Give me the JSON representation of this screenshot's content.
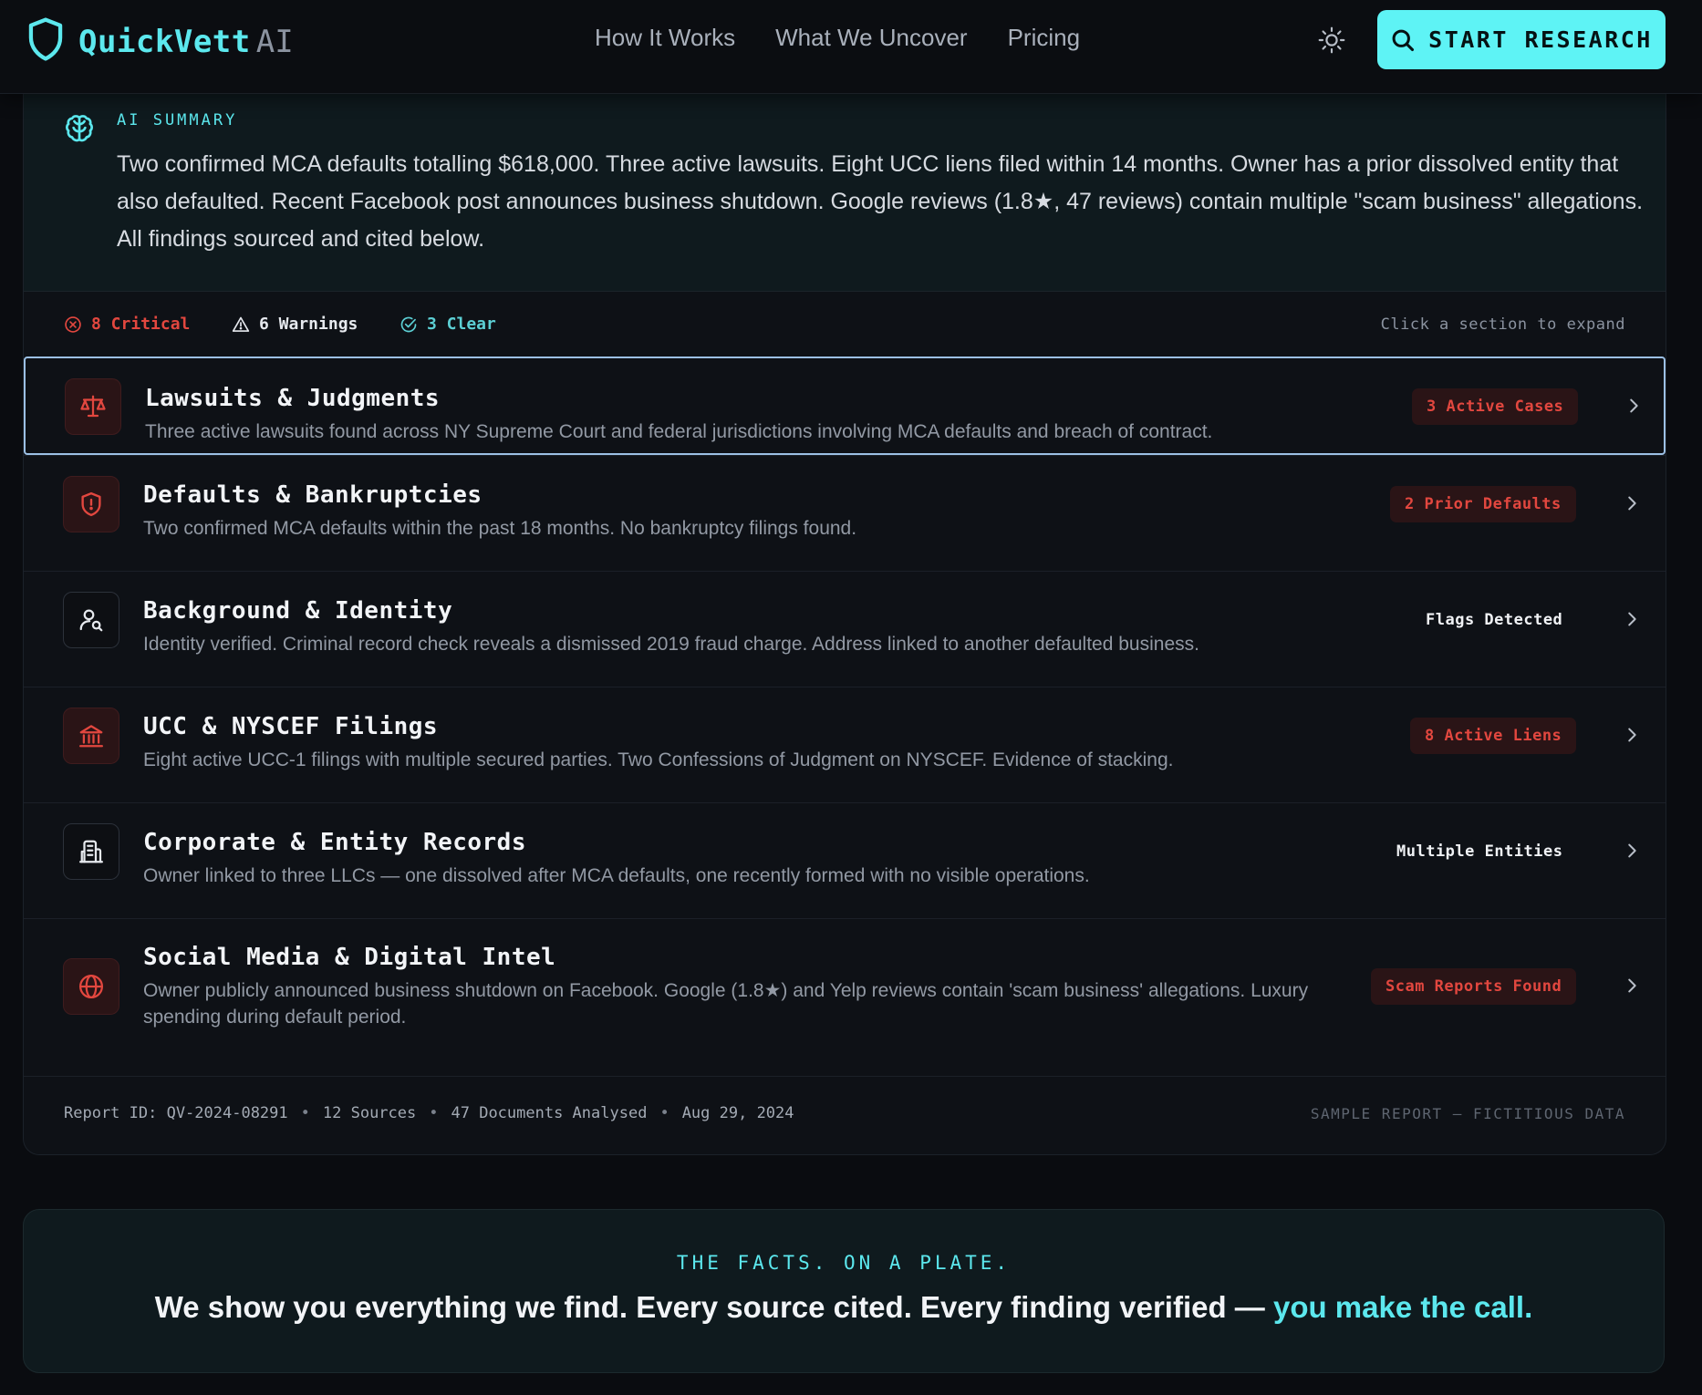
{
  "header": {
    "brand": "QuickVett",
    "brand_suffix": "AI",
    "nav": [
      "How It Works",
      "What We Uncover",
      "Pricing"
    ],
    "cta_label": "START RESEARCH",
    "icons": {
      "logo": "shield-icon",
      "theme": "sun-icon",
      "cta": "search-icon"
    }
  },
  "summary": {
    "label": "AI SUMMARY",
    "text": "Two confirmed MCA defaults totalling $618,000. Three active lawsuits. Eight UCC liens filed within 14 months. Owner has a prior dissolved entity that also defaulted. Recent Facebook post announces business shutdown. Google reviews (1.8★, 47 reviews) contain multiple \"scam business\" allegations. All findings sourced and cited below."
  },
  "status": {
    "critical": "8 Critical",
    "warnings": "6 Warnings",
    "clear": "3 Clear",
    "hint": "Click a section to expand"
  },
  "sections": [
    {
      "title": "Lawsuits & Judgments",
      "desc": "Three active lawsuits found across NY Supreme Court and federal jurisdictions involving MCA defaults and breach of contract.",
      "badge": "3 Active Cases",
      "icon": "scales-icon"
    },
    {
      "title": "Defaults & Bankruptcies",
      "desc": "Two confirmed MCA defaults within the past 18 months. No bankruptcy filings found.",
      "badge": "2 Prior Defaults",
      "icon": "shield-alert-icon"
    },
    {
      "title": "Background & Identity",
      "desc": "Identity verified. Criminal record check reveals a dismissed 2019 fraud charge. Address linked to another defaulted business.",
      "badge": "Flags Detected",
      "icon": "user-search-icon"
    },
    {
      "title": "UCC & NYSCEF Filings",
      "desc": "Eight active UCC-1 filings with multiple secured parties. Two Confessions of Judgment on NYSCEF. Evidence of stacking.",
      "badge": "8 Active Liens",
      "icon": "bank-icon"
    },
    {
      "title": "Corporate & Entity Records",
      "desc": "Owner linked to three LLCs — one dissolved after MCA defaults, one recently formed with no visible operations.",
      "badge": "Multiple Entities",
      "icon": "building-icon"
    },
    {
      "title": "Social Media & Digital Intel",
      "desc": "Owner publicly announced business shutdown on Facebook. Google (1.8★) and Yelp reviews contain 'scam business' allegations. Luxury spending during default period.",
      "badge": "Scam Reports Found",
      "icon": "globe-icon"
    }
  ],
  "footer": {
    "report_id": "Report ID: QV-2024-08291",
    "sources": "12 Sources",
    "documents": "47 Documents Analysed",
    "date": "Aug 29, 2024",
    "separator": "•",
    "disclaimer": "SAMPLE REPORT — FICTITIOUS DATA"
  },
  "facts": {
    "label": "THE FACTS. ON A PLATE.",
    "text": "We show you everything we find. Every source cited. Every finding verified — ",
    "accent": "you make the call."
  },
  "colors": {
    "accent": "#5ce8ee",
    "critical": "#e2473f",
    "clear": "#5ccfd4",
    "background": "#0a0c10"
  }
}
